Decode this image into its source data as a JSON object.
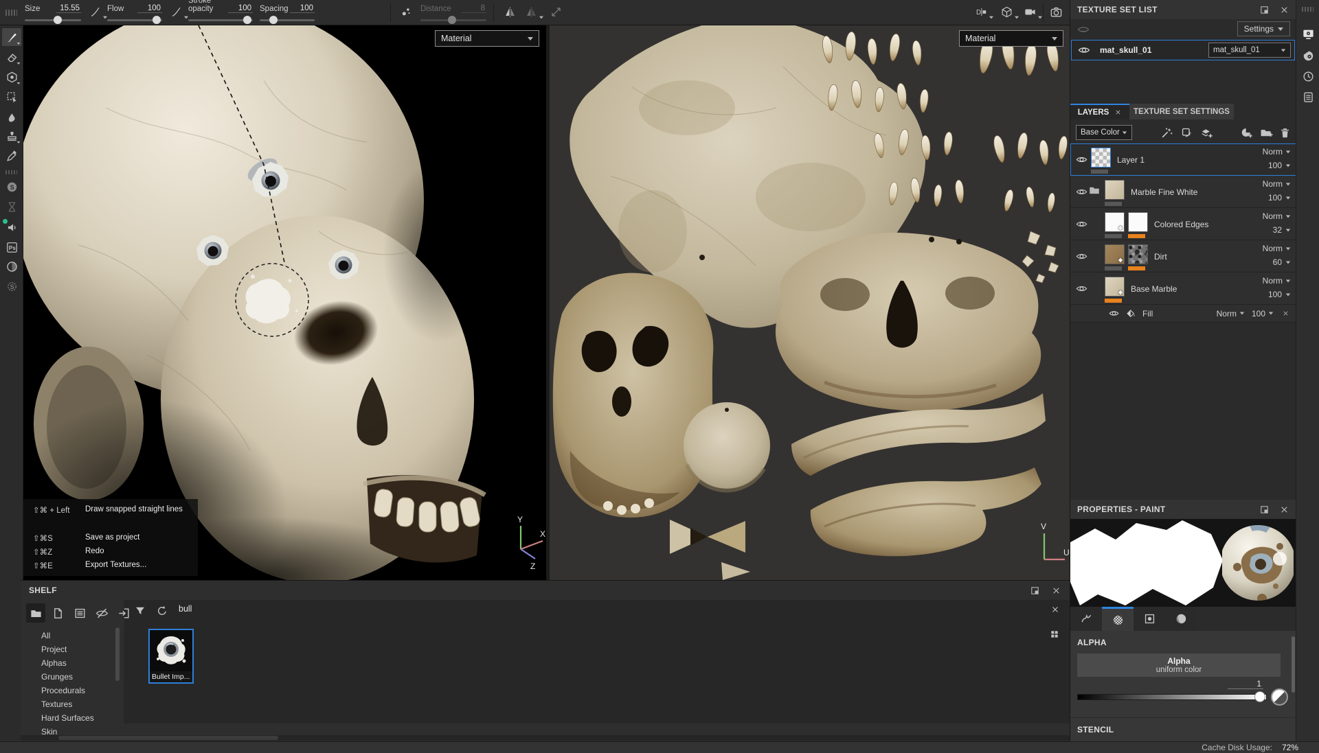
{
  "toolbar": {
    "params": {
      "size": {
        "label": "Size",
        "value": "15.55"
      },
      "flow": {
        "label": "Flow",
        "value": "100"
      },
      "stroke_opacity": {
        "label": "Stroke opacity",
        "value": "100"
      },
      "spacing": {
        "label": "Spacing",
        "value": "100"
      },
      "distance": {
        "label": "Distance",
        "value": "8"
      }
    }
  },
  "viewport": {
    "material_label": "Material",
    "axis3d": {
      "x": "X",
      "y": "Y",
      "z": "Z"
    },
    "axis2d": {
      "u": "U",
      "v": "V"
    }
  },
  "shortcut_overlay": {
    "items": [
      {
        "keys": "⇧⌘ + Left",
        "action": "Draw snapped straight lines"
      },
      {
        "keys": "⇧⌘S",
        "action": "Save as project"
      },
      {
        "keys": "⇧⌘Z",
        "action": "Redo"
      },
      {
        "keys": "⇧⌘E",
        "action": "Export Textures..."
      }
    ]
  },
  "texture_set_list": {
    "title": "TEXTURE SET LIST",
    "settings_button": "Settings",
    "set_name": "mat_skull_01",
    "set_selector": "mat_skull_01"
  },
  "layers_panel": {
    "tabs": {
      "layers": "LAYERS",
      "texture_set_settings": "TEXTURE SET SETTINGS"
    },
    "channel_selector": "Base Color",
    "layers": [
      {
        "name": "Layer 1",
        "blend": "Norm",
        "opacity": "100"
      },
      {
        "name": "Marble Fine White",
        "blend": "Norm",
        "opacity": "100"
      },
      {
        "name": "Colored Edges",
        "blend": "Norm",
        "opacity": "32"
      },
      {
        "name": "Dirt",
        "blend": "Norm",
        "opacity": "60"
      },
      {
        "name": "Base Marble",
        "blend": "Norm",
        "opacity": "100"
      },
      {
        "name": "Fill",
        "blend": "Norm",
        "opacity": "100"
      }
    ]
  },
  "properties_panel": {
    "title": "PROPERTIES - PAINT",
    "alpha_section_title": "ALPHA",
    "alpha_button_title": "Alpha",
    "alpha_button_subtitle": "uniform color",
    "alpha_value": "1",
    "stencil_section_title": "STENCIL"
  },
  "shelf": {
    "title": "SHELF",
    "search_value": "bull",
    "categories": [
      "All",
      "Project",
      "Alphas",
      "Grunges",
      "Procedurals",
      "Textures",
      "Hard Surfaces",
      "Skin"
    ],
    "asset_label": "Bullet Imp..."
  },
  "status_bar": {
    "cache_label": "Cache Disk Usage:",
    "cache_value": "72%"
  },
  "colors": {
    "accent_blue": "#2e7fd9",
    "accent_orange": "#e8821e"
  }
}
